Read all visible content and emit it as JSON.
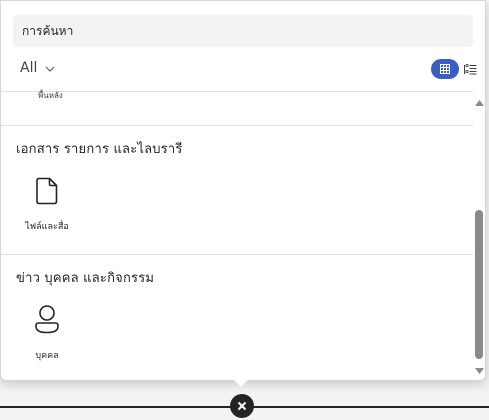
{
  "search": {
    "placeholder": "การค้นหา"
  },
  "filter": {
    "selected": "All"
  },
  "view_toggle": {
    "grid_icon": "grid-icon",
    "list_icon": "list-icon",
    "accent": "#3b5fc0"
  },
  "partial_item": {
    "label": "พื้นหลัง"
  },
  "sections": [
    {
      "title": "เอกสาร รายการ และไลบรารี",
      "items": [
        {
          "label": "ไฟล์และสื่อ",
          "icon": "file-icon"
        }
      ]
    },
    {
      "title": "ข่าว บุคคล และกิจกรรม",
      "items": [
        {
          "label": "บุคคล",
          "icon": "person-icon"
        }
      ]
    }
  ],
  "close": {
    "icon": "close-icon"
  }
}
